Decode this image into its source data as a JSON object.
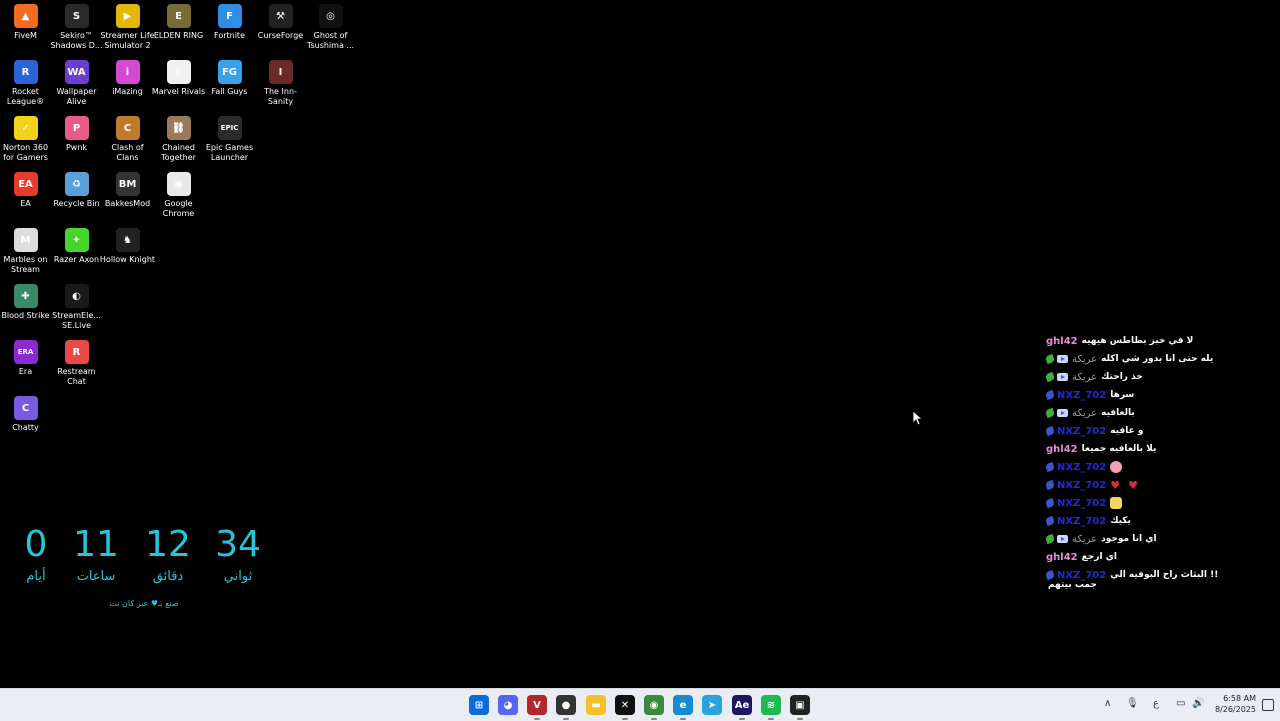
{
  "desktop_icons": [
    {
      "label": "FiveM",
      "color": "#f26b21",
      "glyph": "▲"
    },
    {
      "label": "Sekiro™ Shadows D...",
      "color": "#2a2a2a",
      "glyph": "S"
    },
    {
      "label": "Streamer Life Simulator 2",
      "color": "#e6b800",
      "glyph": "▶"
    },
    {
      "label": "ELDEN RING",
      "color": "#7a6a3a",
      "glyph": "E"
    },
    {
      "label": "Fortnite",
      "color": "#2f8fe6",
      "glyph": "F"
    },
    {
      "label": "CurseForge",
      "color": "#222",
      "glyph": "⚒"
    },
    {
      "label": "Ghost of Tsushima ...",
      "color": "#111",
      "glyph": "◎"
    },
    {
      "label": "Rocket League®",
      "color": "#2b63d8",
      "glyph": "R"
    },
    {
      "label": "Wallpaper Alive",
      "color": "#6a3fd0",
      "glyph": "WA"
    },
    {
      "label": "iMazing",
      "color": "#d24bd2",
      "glyph": "i"
    },
    {
      "label": "Marvel Rivals",
      "color": "#f0f0f0",
      "glyph": "▯"
    },
    {
      "label": "Fall Guys",
      "color": "#3aa0e8",
      "glyph": "FG"
    },
    {
      "label": "The Inn-Sanity",
      "color": "#6b2a2a",
      "glyph": "I"
    },
    {
      "label": "Norton 360 for Gamers",
      "color": "#f2d21b",
      "glyph": "✓"
    },
    {
      "label": "Pwnk",
      "color": "#e85a8a",
      "glyph": "P"
    },
    {
      "label": "Clash of Clans",
      "color": "#c07a2a",
      "glyph": "C"
    },
    {
      "label": "Chained Together",
      "color": "#9a7a5a",
      "glyph": "⛓"
    },
    {
      "label": "Epic Games Launcher",
      "color": "#2b2b2b",
      "glyph": "EPIC"
    },
    {
      "label": "EA",
      "color": "#e53d2a",
      "glyph": "EA"
    },
    {
      "label": "Recycle Bin",
      "color": "#5aa0d8",
      "glyph": "♻"
    },
    {
      "label": "BakkesMod",
      "color": "#333",
      "glyph": "BM"
    },
    {
      "label": "Google Chrome",
      "color": "#e8e8e8",
      "glyph": "◉"
    },
    {
      "label": "Marbles on Stream",
      "color": "#ddd",
      "glyph": "M"
    },
    {
      "label": "Razer Axon",
      "color": "#44d62c",
      "glyph": "✦"
    },
    {
      "label": "Hollow Knight",
      "color": "#222",
      "glyph": "♞"
    },
    {
      "label": "Blood Strike",
      "color": "#3a8a6a",
      "glyph": "✚"
    },
    {
      "label": "StreamEle... SE.Live",
      "color": "#1a1a1a",
      "glyph": "◐"
    },
    {
      "label": "Era",
      "color": "#8a2ad0",
      "glyph": "ERA"
    },
    {
      "label": "Restream Chat",
      "color": "#e84a4a",
      "glyph": "R"
    },
    {
      "label": "Chatty",
      "color": "#7a5ae0",
      "glyph": "C"
    }
  ],
  "countdown": {
    "units": [
      {
        "num": "0",
        "label": "أيام"
      },
      {
        "num": "11",
        "label": "ساعات"
      },
      {
        "num": "12",
        "label": "دقائق"
      },
      {
        "num": "34",
        "label": "ثواني"
      }
    ],
    "footer": "صنع بـ♥ عبر كان نت"
  },
  "chat": [
    {
      "user": "ghl42",
      "ucls": "u-pink",
      "badges": [],
      "text": "لا في خبز بطاطس هيهيه"
    },
    {
      "user": "عريكة",
      "ucls": "u-gray",
      "badges": [
        "leaf",
        "yt"
      ],
      "text": "يله حتى انا بدور شي اكله"
    },
    {
      "user": "عريكة",
      "ucls": "u-gray",
      "badges": [
        "leaf",
        "yt"
      ],
      "text": "خذ راحتك"
    },
    {
      "user": "NXZ_702",
      "ucls": "u-blue",
      "badges": [
        "leaf-blue"
      ],
      "text": "سرها"
    },
    {
      "user": "عريكة",
      "ucls": "u-gray",
      "badges": [
        "leaf",
        "yt"
      ],
      "text": "بالعافيه"
    },
    {
      "user": "NXZ_702",
      "ucls": "u-blue",
      "badges": [
        "leaf-blue"
      ],
      "text": "و عافيه"
    },
    {
      "user": "ghl42",
      "ucls": "u-pink",
      "badges": [],
      "text": "يلا بالعافيه جميعا"
    },
    {
      "user": "NXZ_702",
      "ucls": "u-blue",
      "badges": [
        "leaf-blue"
      ],
      "text": "",
      "emote": "face"
    },
    {
      "user": "NXZ_702",
      "ucls": "u-blue",
      "badges": [
        "leaf-blue"
      ],
      "text": "",
      "emote": "hearts"
    },
    {
      "user": "NXZ_702",
      "ucls": "u-blue",
      "badges": [
        "leaf-blue"
      ],
      "text": "",
      "emote": "pop"
    },
    {
      "user": "NXZ_702",
      "ucls": "u-blue",
      "badges": [
        "leaf-blue"
      ],
      "text": "يكيك"
    },
    {
      "user": "عريكة",
      "ucls": "u-gray",
      "badges": [
        "leaf",
        "yt"
      ],
      "text": "اي انا موجود"
    },
    {
      "user": "ghl42",
      "ucls": "u-pink",
      "badges": [],
      "text": "اي ارجع"
    },
    {
      "user": "NXZ_702",
      "ucls": "u-blue",
      "badges": [
        "leaf-blue"
      ],
      "text": "البثاث راح البوفيه الي !!",
      "wrap": "جمب بيتهم"
    }
  ],
  "taskbar": {
    "apps": [
      {
        "name": "windows-start",
        "color": "#0a6cd8",
        "glyph": "⊞"
      },
      {
        "name": "discord",
        "color": "#5865f2",
        "glyph": "◕"
      },
      {
        "name": "voice-mod",
        "color": "#b3262b",
        "glyph": "V"
      },
      {
        "name": "obs",
        "color": "#333",
        "glyph": "●"
      },
      {
        "name": "file-explorer",
        "color": "#f4c12a",
        "glyph": "▬"
      },
      {
        "name": "capcut",
        "color": "#111",
        "glyph": "✕"
      },
      {
        "name": "chrome",
        "color": "#3b8a3b",
        "glyph": "◉"
      },
      {
        "name": "edge",
        "color": "#1a8ad0",
        "glyph": "e"
      },
      {
        "name": "telegram",
        "color": "#2aa3e0",
        "glyph": "➤"
      },
      {
        "name": "after-effects",
        "color": "#1f1563",
        "glyph": "Ae"
      },
      {
        "name": "spotify",
        "color": "#1db954",
        "glyph": "≋"
      },
      {
        "name": "streamlabs",
        "color": "#222",
        "glyph": "▣"
      }
    ],
    "tray": {
      "chevron": "∧",
      "mic": "🎙",
      "lang": "ع",
      "net": "▭",
      "vol": "🔊"
    },
    "time": "6:58 AM",
    "date": "8/26/2025"
  }
}
